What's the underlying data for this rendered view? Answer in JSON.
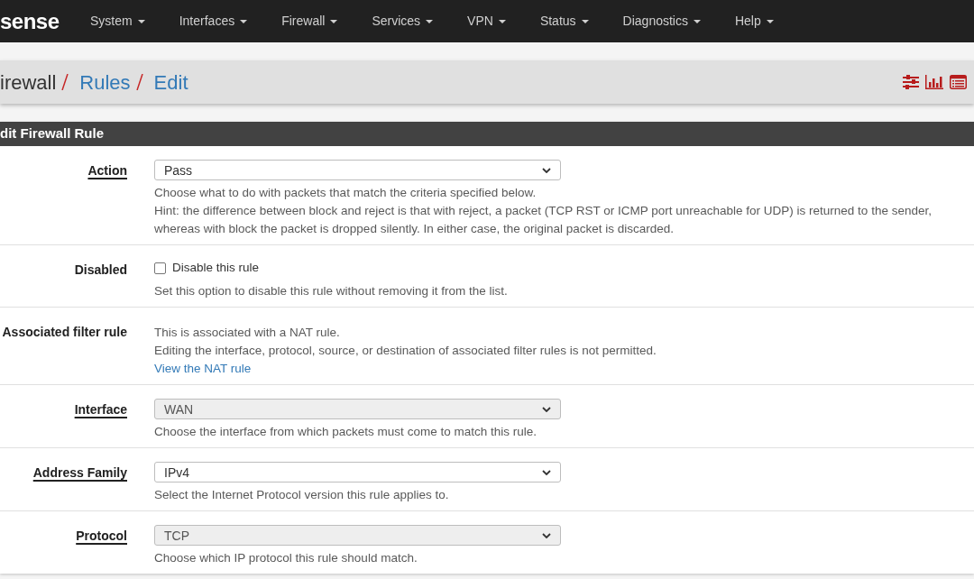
{
  "navbar": {
    "logo": "sense",
    "menu": [
      {
        "label": "System"
      },
      {
        "label": "Interfaces"
      },
      {
        "label": "Firewall"
      },
      {
        "label": "Services"
      },
      {
        "label": "VPN"
      },
      {
        "label": "Status"
      },
      {
        "label": "Diagnostics"
      },
      {
        "label": "Help"
      }
    ]
  },
  "breadcrumb": [
    {
      "label": "irewall",
      "link": false
    },
    {
      "label": "Rules",
      "link": true
    },
    {
      "label": "Edit",
      "link": true
    }
  ],
  "panel": {
    "title": "dit Firewall Rule",
    "rows": [
      {
        "kind": "select",
        "label": "Action",
        "help_link": true,
        "value": "Pass",
        "disabled": false,
        "help": [
          "Choose what to do with packets that match the criteria specified below.",
          "Hint: the difference between block and reject is that with reject, a packet (TCP RST or ICMP port unreachable for UDP) is returned to the sender, whereas with block the packet is dropped silently. In either case, the original packet is discarded."
        ]
      },
      {
        "kind": "checkbox",
        "label": "Disabled",
        "help_link": false,
        "checkbox_label": "Disable this rule",
        "checked": false,
        "help": [
          "Set this option to disable this rule without removing it from the list."
        ]
      },
      {
        "kind": "info",
        "label": "Associated filter rule",
        "help_link": false,
        "help": [
          "This is associated with a NAT rule.",
          "Editing the interface, protocol, source, or destination of associated filter rules is not permitted."
        ],
        "link": "View the NAT rule"
      },
      {
        "kind": "select",
        "label": "Interface",
        "help_link": true,
        "value": "WAN",
        "disabled": true,
        "help": [
          "Choose the interface from which packets must come to match this rule."
        ]
      },
      {
        "kind": "select",
        "label": "Address Family",
        "help_link": true,
        "value": "IPv4",
        "disabled": false,
        "help": [
          "Select the Internet Protocol version this rule applies to."
        ]
      },
      {
        "kind": "select",
        "label": "Protocol",
        "help_link": true,
        "value": "TCP",
        "disabled": true,
        "help": [
          "Choose which IP protocol this rule should match."
        ]
      }
    ]
  }
}
